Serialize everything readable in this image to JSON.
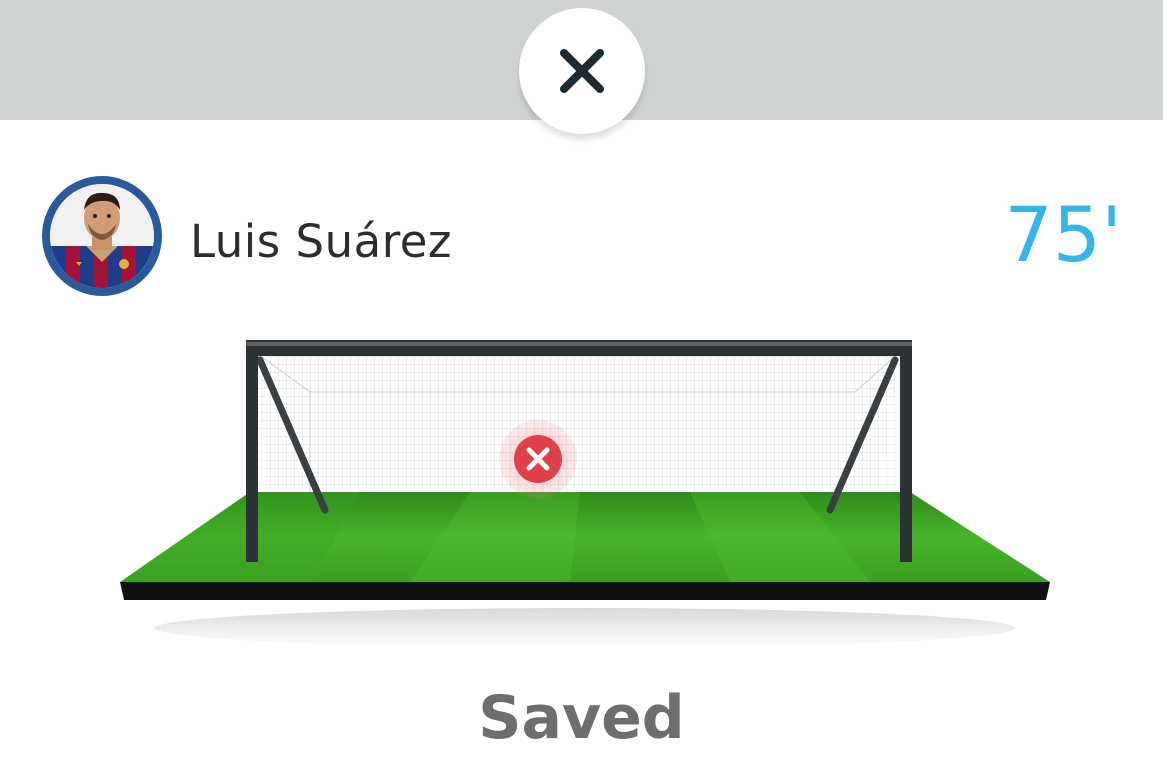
{
  "header": {
    "close_icon": "close-icon"
  },
  "player": {
    "name": "Luis Suárez",
    "avatar_icon": "player-avatar",
    "ring_color": "#2a5a9b"
  },
  "event": {
    "minute": "75'",
    "minute_color": "#34b6e6",
    "shot_marker_icon": "x-circle-icon",
    "marker_color": "#e0404a",
    "result": "Saved"
  }
}
